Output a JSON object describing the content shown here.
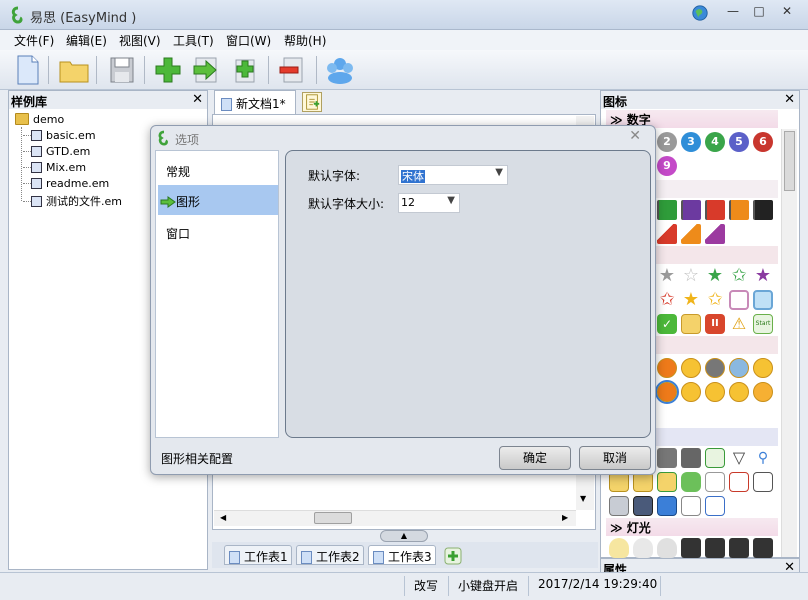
{
  "window": {
    "title": "易思 (EasyMind )",
    "min": "—",
    "max": "□",
    "close": "✕"
  },
  "menu": [
    "文件(F)",
    "编辑(E)",
    "视图(V)",
    "工具(T)",
    "窗口(W)",
    "帮助(H)"
  ],
  "sample_panel": {
    "title": "样例库",
    "close": "✕",
    "root": "demo",
    "files": [
      "basic.em",
      "GTD.em",
      "Mix.em",
      "readme.em",
      "测试的文件.em"
    ]
  },
  "document": {
    "tab_label": "新文档1*",
    "sheets": [
      "工作表1",
      "工作表2",
      "工作表3"
    ],
    "active_sheet": 2
  },
  "icons_panel": {
    "title": "图标",
    "close": "✕",
    "categories": {
      "numbers": "数字",
      "lights": "灯光"
    },
    "number_badges": [
      "2",
      "3",
      "4",
      "5",
      "6",
      "9"
    ]
  },
  "properties_panel": {
    "title": "属性",
    "close": "✕"
  },
  "status": {
    "mode": "改写",
    "keyboard": "小键盘开启",
    "datetime": "2017/2/14 19:29:40"
  },
  "dialog": {
    "title": "选项",
    "close": "✕",
    "nav": [
      "常规",
      "图形",
      "窗口"
    ],
    "selected_nav": 1,
    "font_label": "默认字体:",
    "font_value": "宋体",
    "size_label": "默认字体大小:",
    "size_value": "12",
    "footer": "图形相关配置",
    "ok": "确定",
    "cancel": "取消"
  },
  "colors": {
    "accent": "#a8c8f0",
    "selection": "#3073d0",
    "category_bg": "#f3dbe8"
  }
}
